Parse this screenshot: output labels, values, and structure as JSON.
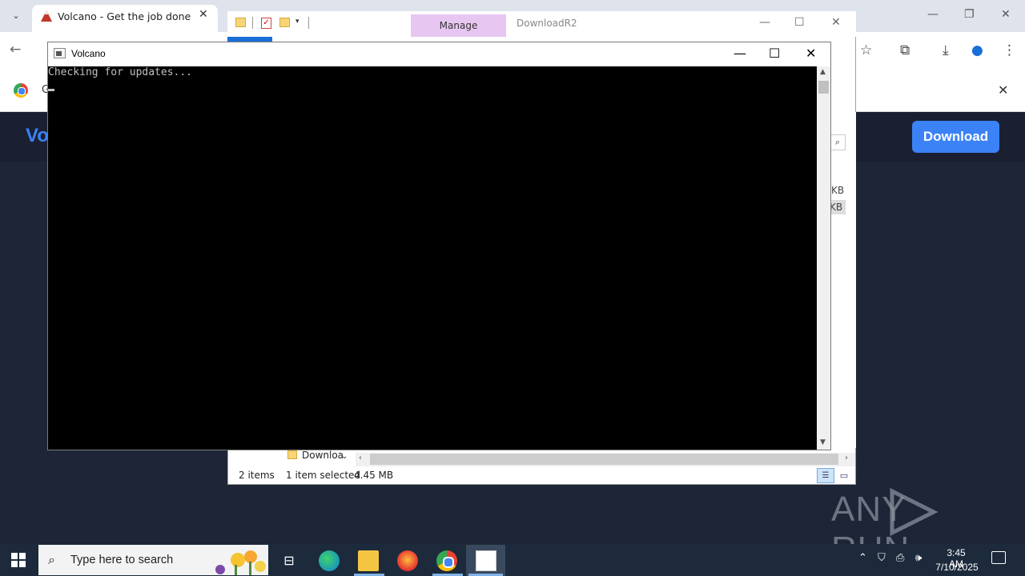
{
  "browser": {
    "tab_title": "Volcano - Get the job done",
    "tab_close": "✕",
    "infobar_text": "G",
    "site_logo": "Vo",
    "download_label": "Download",
    "help": "?"
  },
  "explorer": {
    "manage_tab": "Manage",
    "title": "DownloadR2",
    "size_col_1": "KB",
    "size_col_2": "KB",
    "nav_item": "Downloa",
    "status_items": "2 items",
    "status_selected": "1 item selected",
    "status_size": "4.45 MB"
  },
  "console": {
    "title": "Volcano",
    "output": "Checking for updates..."
  },
  "watermark": {
    "left": "ANY",
    "right": "RUN"
  },
  "taskbar": {
    "search_placeholder": "Type here to search",
    "time": "3:45 AM",
    "date": "7/10/2025"
  },
  "colors": {
    "site_bg": "#1e2537",
    "accent_blue": "#3b82f6",
    "console_bg": "#000000",
    "taskbar_bg": "#1c2a3c"
  }
}
